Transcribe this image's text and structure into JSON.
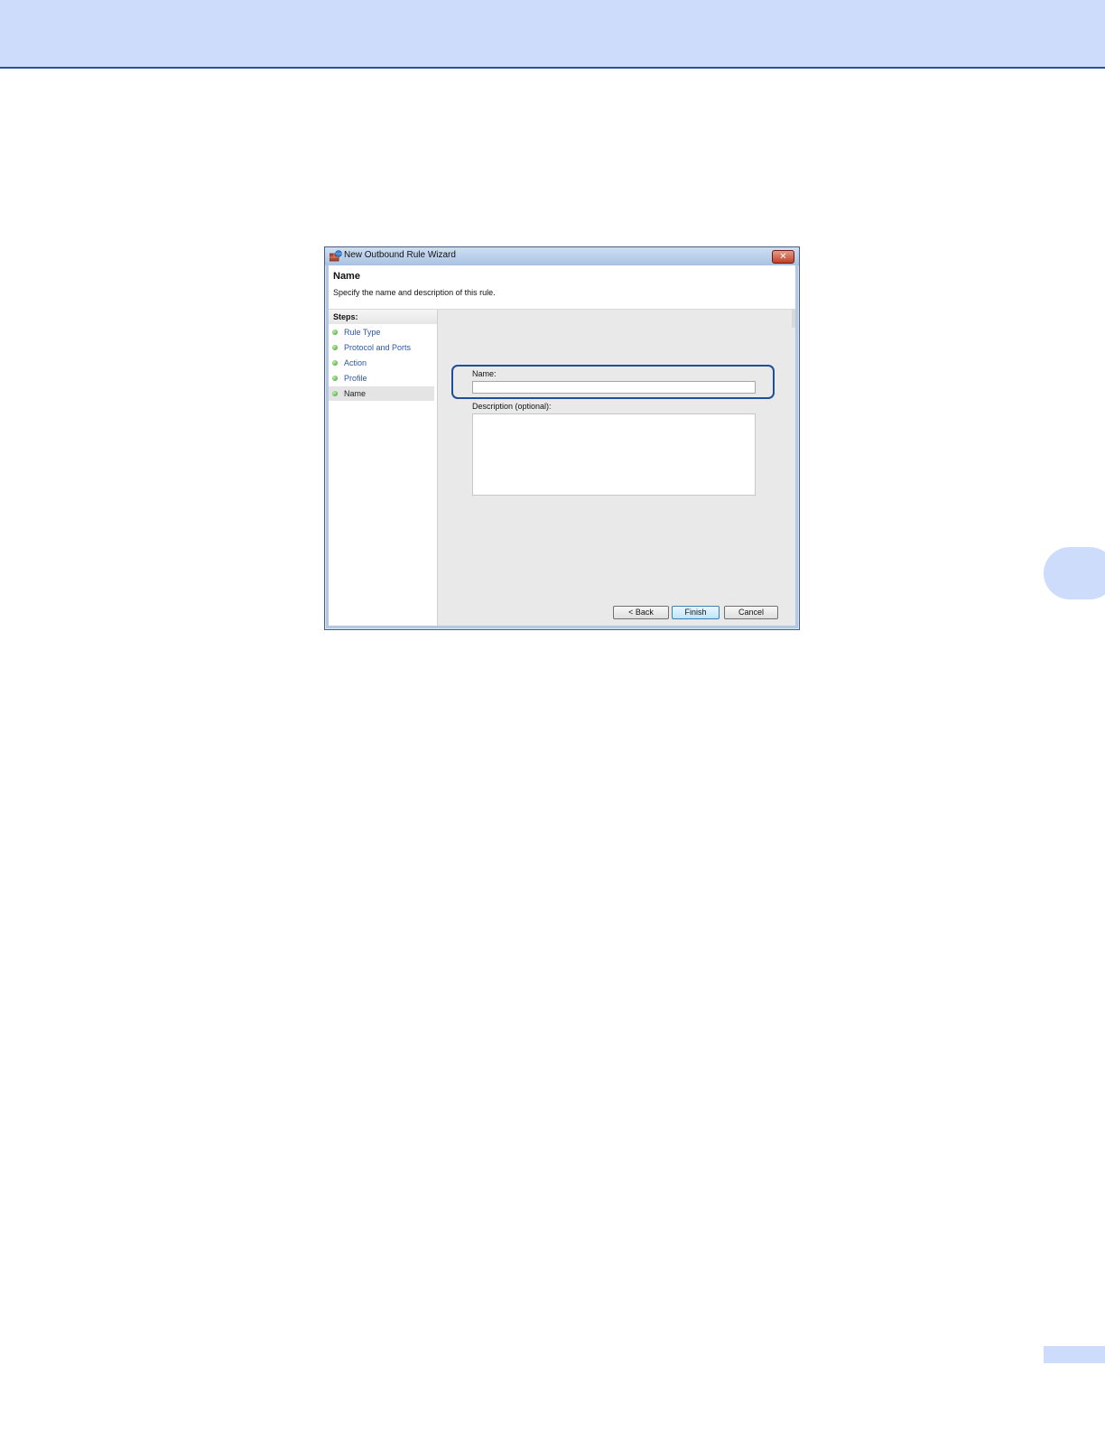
{
  "window": {
    "title": "New Outbound Rule Wizard",
    "close_glyph": "✕"
  },
  "header": {
    "title": "Name",
    "subtitle": "Specify the name and description of this rule."
  },
  "steps": {
    "heading": "Steps:",
    "items": [
      {
        "label": "Rule Type"
      },
      {
        "label": "Protocol and Ports"
      },
      {
        "label": "Action"
      },
      {
        "label": "Profile"
      },
      {
        "label": "Name"
      }
    ],
    "current_index": 4
  },
  "form": {
    "name_label": "Name:",
    "name_value": "",
    "description_label": "Description (optional):",
    "description_value": ""
  },
  "buttons": {
    "back": "< Back",
    "finish": "Finish",
    "cancel": "Cancel"
  },
  "colors": {
    "header_band": "#cddcfb",
    "header_rule": "#2a4ea0",
    "highlight_border": "#1f4e9a",
    "step_link": "#2c55a8",
    "step_bullet": "#3c9a2c"
  }
}
